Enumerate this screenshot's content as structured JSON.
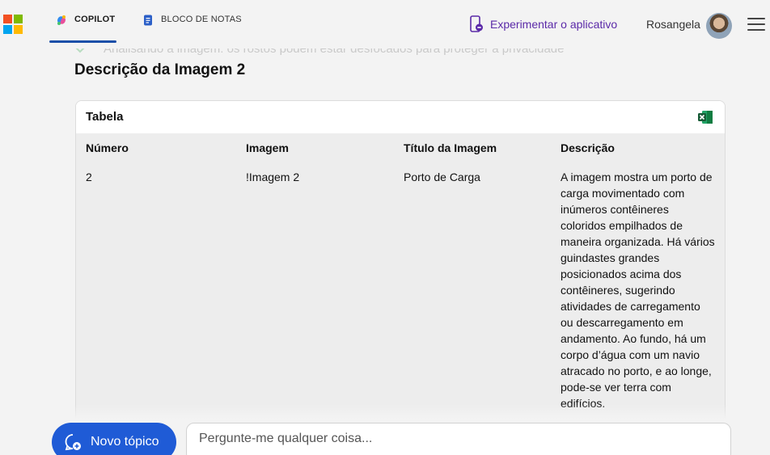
{
  "header": {
    "tabs": [
      {
        "label": "COPILOT",
        "icon": "copilot-icon",
        "active": true
      },
      {
        "label": "BLOCO DE NOTAS",
        "icon": "notebook-icon",
        "active": false
      }
    ],
    "try_app_label": "Experimentar o aplicativo",
    "user_name": "Rosangela"
  },
  "content": {
    "analyzing_text": "Analisando a imagem: os rostos podem estar desfocados para proteger a privacidade",
    "section_title": "Descrição da Imagem 2",
    "table": {
      "title": "Tabela",
      "columns": [
        "Número",
        "Imagem",
        "Título da Imagem",
        "Descrição"
      ],
      "rows": [
        [
          "2",
          "!Imagem 2",
          "Porto de Carga",
          "A imagem mostra um porto de carga movimentado com inúmeros contêineres coloridos empilhados de maneira organizada. Há vários guindastes grandes posicionados acima dos contêineres, sugerindo atividades de carregamento ou descarregamento em andamento. Ao fundo, há um corpo d’água com um navio atracado no porto, e ao longe, pode-se ver terra com edifícios."
        ]
      ]
    }
  },
  "composer": {
    "new_topic_label": "Novo tópico",
    "placeholder": "Pergunte-me qualquer coisa..."
  },
  "colors": {
    "accent": "#1f5bd6",
    "try_app": "#5b2aa8",
    "ms_red": "#f25022",
    "ms_green": "#7fba00",
    "ms_blue": "#00a4ef",
    "ms_yellow": "#ffb900"
  }
}
